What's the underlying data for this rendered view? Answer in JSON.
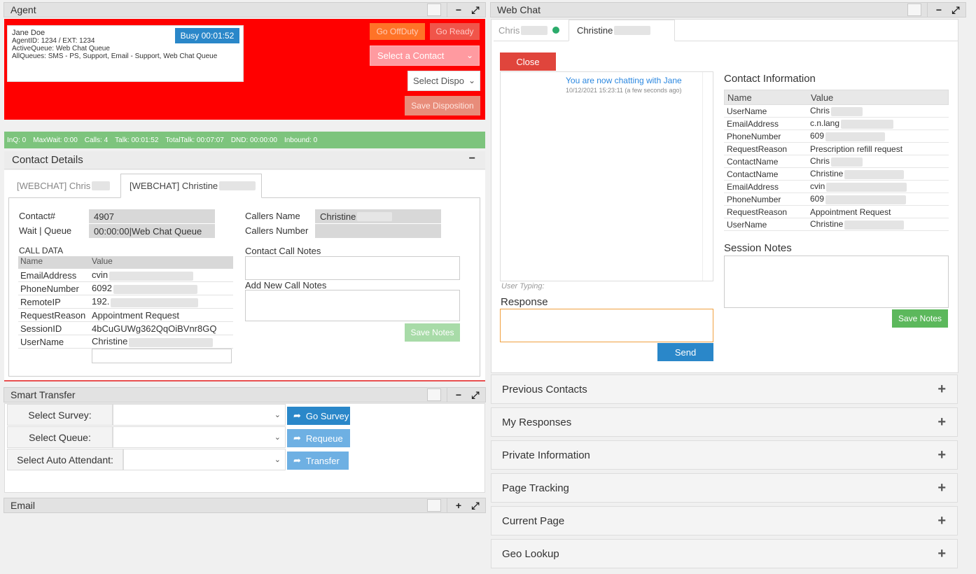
{
  "agent_panel": {
    "title": "Agent",
    "name": "Jane Doe",
    "agent_id": "AgentID: 1234 / EXT: 1234",
    "active_queue": "ActiveQueue: Web Chat Queue",
    "all_queues": "AllQueues: SMS - PS, Support, Email - Support, Web Chat Queue",
    "status_badge": "Busy 00:01:52",
    "go_offduty": "Go OffDuty",
    "go_ready": "Go Ready",
    "select_contact": "Select a Contact",
    "select_dispo": "Select Dispo",
    "save_disposition": "Save Disposition",
    "accent_color": "#ff0000"
  },
  "stats": [
    "InQ: 0",
    "MaxWait: 0:00",
    "Calls: 4",
    "Talk: 00:01:52",
    "TotalTalk: 00:07:07",
    "DND: 00:00:00",
    "Inbound: 0"
  ],
  "contact_details": {
    "title": "Contact Details",
    "tabs": [
      {
        "label": "[WEBCHAT] Chris"
      },
      {
        "label": "[WEBCHAT] Christine"
      }
    ],
    "contact_num_label": "Contact#",
    "contact_num": "4907",
    "wait_queue_label": "Wait | Queue",
    "wait_queue": "00:00:00|Web Chat Queue",
    "callers_name_label": "Callers Name",
    "callers_name": "Christine",
    "callers_number_label": "Callers Number",
    "call_data_label": "CALL DATA",
    "call_data_headers": [
      "Name",
      "Value"
    ],
    "call_data_rows": [
      {
        "name": "EmailAddress",
        "value": "cvin"
      },
      {
        "name": "PhoneNumber",
        "value": "6092"
      },
      {
        "name": "RemoteIP",
        "value": "192."
      },
      {
        "name": "RequestReason",
        "value": "Appointment Request"
      },
      {
        "name": "SessionID",
        "value": "4bCuGUWg362QqOiBVnr8GQ"
      },
      {
        "name": "UserName",
        "value": "Christine"
      }
    ],
    "contact_call_notes_label": "Contact Call Notes",
    "add_new_call_notes_label": "Add New Call Notes",
    "save_notes": "Save Notes"
  },
  "smart_transfer": {
    "title": "Smart Transfer",
    "select_survey_label": "Select Survey:",
    "select_queue_label": "Select Queue:",
    "select_auto_attendant_label": "Select Auto Attendant:",
    "go_survey": "Go Survey",
    "requeue": "Requeue",
    "transfer": "Transfer"
  },
  "email_panel": {
    "title": "Email"
  },
  "web_chat": {
    "title": "Web Chat",
    "tabs": [
      {
        "label": "Chris"
      },
      {
        "label": "Christine"
      }
    ],
    "close": "Close",
    "chat_message": "You are now chatting with Jane",
    "chat_timestamp": "10/12/2021 15:23:11 (a few seconds ago)",
    "user_typing": "User Typing:",
    "response_label": "Response",
    "send": "Send",
    "contact_info_title": "Contact Information",
    "contact_info_headers": [
      "Name",
      "Value"
    ],
    "contact_info_rows": [
      {
        "name": "UserName",
        "value": "Chris"
      },
      {
        "name": "EmailAddress",
        "value": "c.n.lang"
      },
      {
        "name": "PhoneNumber",
        "value": "609"
      },
      {
        "name": "RequestReason",
        "value": "Prescription refill request"
      },
      {
        "name": "ContactName",
        "value": "Chris"
      },
      {
        "name": "ContactName",
        "value": "Christine"
      },
      {
        "name": "EmailAddress",
        "value": "cvin"
      },
      {
        "name": "PhoneNumber",
        "value": "609"
      },
      {
        "name": "RequestReason",
        "value": "Appointment Request"
      },
      {
        "name": "UserName",
        "value": "Christine"
      }
    ],
    "session_notes_title": "Session Notes",
    "save_notes": "Save Notes"
  },
  "accordions": [
    {
      "label": "Previous Contacts"
    },
    {
      "label": "My Responses"
    },
    {
      "label": "Private Information"
    },
    {
      "label": "Page Tracking"
    },
    {
      "label": "Current Page"
    },
    {
      "label": "Geo Lookup"
    }
  ],
  "icons": {
    "minimize": "minus-icon",
    "expand": "expand-icon",
    "plus": "plus-icon"
  }
}
